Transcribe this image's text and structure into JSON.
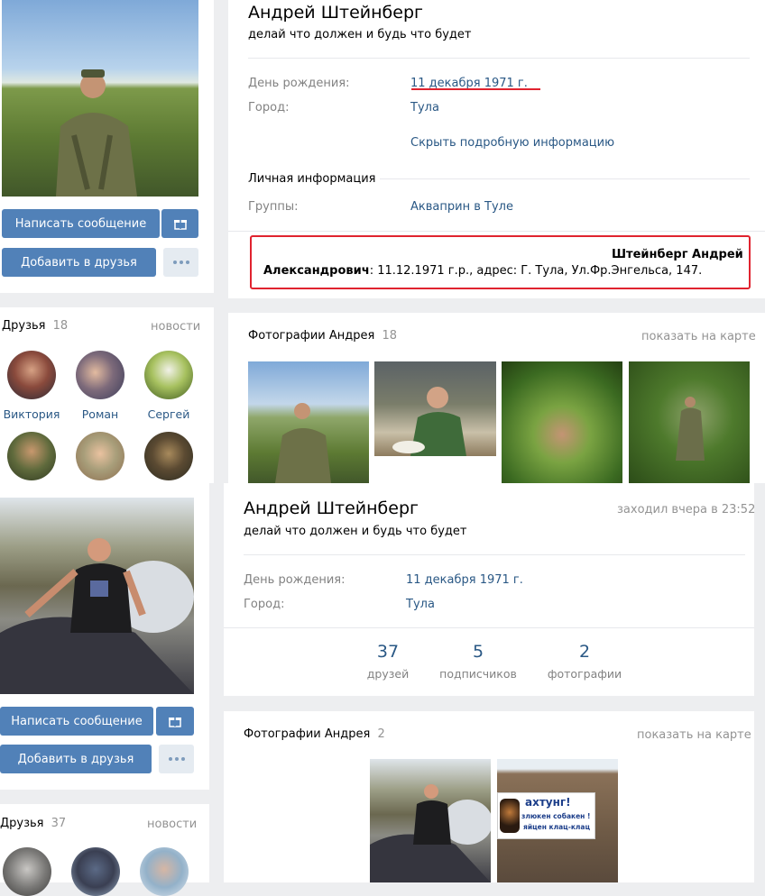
{
  "top_profile": {
    "name": "Андрей Штейнберг",
    "status": "делай что должен и будь что будет",
    "birthday_label": "День рождения:",
    "birthday_value": "11 декабря 1971 г.",
    "city_label": "Город:",
    "city_value": "Тула",
    "hide_details": "Скрыть подробную информацию",
    "personal_info_heading": "Личная информация",
    "groups_label": "Группы:",
    "groups_value": "Акваприн в Туле",
    "send_message": "Написать сообщение",
    "add_friend": "Добавить в друзья",
    "note_name_line1": "Штейнберг Андрей",
    "note_name_line2": "Александрович",
    "note_rest": ": 11.12.1971 г.р., адрес: Г. Тула, Ул.Фр.Энгельса, 147.",
    "friends_heading": "Друзья",
    "friends_count": "18",
    "news": "новости",
    "friends": [
      "Виктория",
      "Роман",
      "Сергей"
    ],
    "photos_heading": "Фотографии Андрея",
    "photos_count": "18",
    "show_on_map": "показать на карте"
  },
  "bottom_profile": {
    "name": "Андрей Штейнберг",
    "last_seen": "заходил вчера в 23:52",
    "status": "делай что должен и будь что будет",
    "birthday_label": "День рождения:",
    "birthday_value": "11 декабря 1971 г.",
    "city_label": "Город:",
    "city_value": "Тула",
    "counters": [
      {
        "num": "37",
        "label": "друзей"
      },
      {
        "num": "5",
        "label": "подписчиков"
      },
      {
        "num": "2",
        "label": "фотографии"
      }
    ],
    "send_message": "Написать сообщение",
    "add_friend": "Добавить в друзья",
    "friends_heading": "Друзья",
    "friends_count": "37",
    "news": "новости",
    "photos_heading": "Фотографии Андрея",
    "photos_count": "2",
    "show_on_map": "показать на карте",
    "sign_line1": "ахтунг!",
    "sign_line2": "злюкен собакен !",
    "sign_line3": "яйцен клац-клац"
  },
  "colors": {
    "accent": "#5181b8",
    "link": "#2a5885",
    "highlight_red": "#e0232f"
  }
}
